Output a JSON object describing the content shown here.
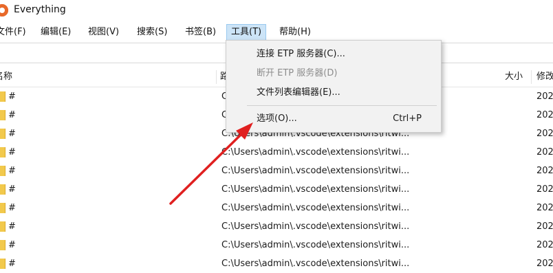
{
  "window": {
    "title": "Everything"
  },
  "menubar": [
    {
      "label": "文件(F)",
      "active": false
    },
    {
      "label": "编辑(E)",
      "active": false
    },
    {
      "label": "视图(V)",
      "active": false
    },
    {
      "label": "搜索(S)",
      "active": false
    },
    {
      "label": "书签(B)",
      "active": false
    },
    {
      "label": "工具(T)",
      "active": true
    },
    {
      "label": "帮助(H)",
      "active": false
    }
  ],
  "columns": {
    "name": "名称",
    "path": "路",
    "size": "大小",
    "modified": "修改"
  },
  "tools_menu": [
    {
      "label": "连接 ETP 服务器(C)...",
      "shortcut": "",
      "disabled": false
    },
    {
      "label": "断开 ETP 服务器(D)",
      "shortcut": "",
      "disabled": true
    },
    {
      "label": "文件列表编辑器(E)...",
      "shortcut": "",
      "disabled": false
    },
    {
      "label": "选项(O)...",
      "shortcut": "Ctrl+P",
      "disabled": false
    }
  ],
  "rows": [
    {
      "name": "#",
      "path": "C",
      "modified": "202"
    },
    {
      "name": "#",
      "path": "C",
      "modified": "202"
    },
    {
      "name": "#",
      "path": "C:\\Users\\admin\\.vscode\\extensions\\ritwi...",
      "modified": "202"
    },
    {
      "name": "#",
      "path": "C:\\Users\\admin\\.vscode\\extensions\\ritwi...",
      "modified": "202"
    },
    {
      "name": "#",
      "path": "C:\\Users\\admin\\.vscode\\extensions\\ritwi...",
      "modified": "202"
    },
    {
      "name": "#",
      "path": "C:\\Users\\admin\\.vscode\\extensions\\ritwi...",
      "modified": "202"
    },
    {
      "name": "#",
      "path": "C:\\Users\\admin\\.vscode\\extensions\\ritwi...",
      "modified": "202"
    },
    {
      "name": "#",
      "path": "C:\\Users\\admin\\.vscode\\extensions\\ritwi...",
      "modified": "202"
    },
    {
      "name": "#",
      "path": "C:\\Users\\admin\\.vscode\\extensions\\ritwi...",
      "modified": "202"
    },
    {
      "name": "#",
      "path": "C:\\Users\\admin\\.vscode\\extensions\\ritwi...",
      "modified": "202"
    }
  ],
  "colors": {
    "menu_highlight": "#cce4f7",
    "folder": "#f2c94c",
    "annotation_arrow": "#e02020",
    "app_icon": "#e8692a"
  },
  "icons": {
    "app": "everything-app-icon",
    "folder": "folder-icon"
  }
}
